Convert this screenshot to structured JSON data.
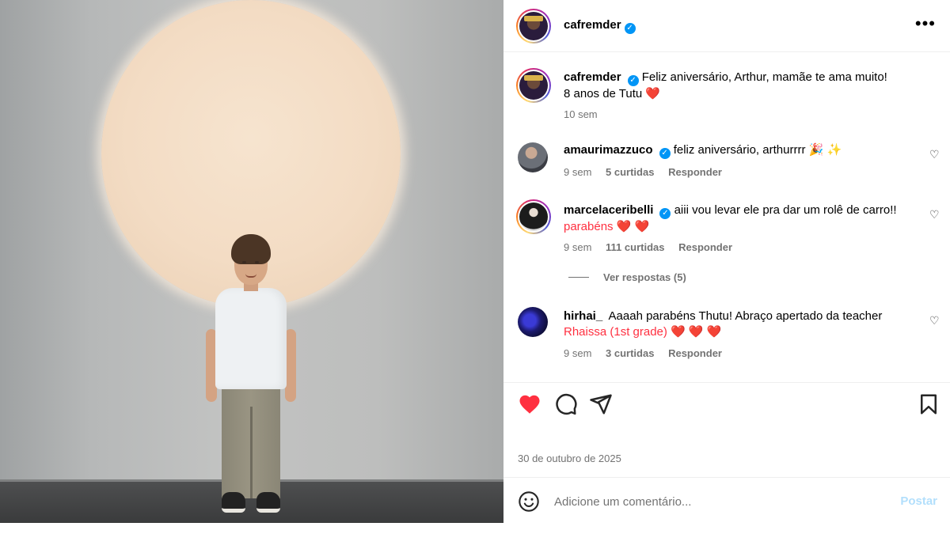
{
  "post": {
    "author": "cafremder",
    "caption_line1": "Feliz aniversário, Arthur, mamãe te ama muito!",
    "caption_line2": "8 anos de Tutu",
    "caption_emoji": "❤️",
    "caption_time": "10 sem",
    "date": "30 de outubro de 2025",
    "liked": true,
    "accent_color": "#0095f6",
    "like_color": "#ff3040"
  },
  "comments": [
    {
      "username": "amaurimazzuco",
      "verified": true,
      "text": "feliz aniversário, arthurrrr 🎉 ✨",
      "time": "9 sem",
      "likes": "5 curtidas",
      "reply": "Responder"
    },
    {
      "username": "marcelaceribelli",
      "verified": true,
      "text": "aiii vou levar ele pra dar um rolê de carro!!",
      "text_line2": "parabéns ❤️ ❤️",
      "time": "9 sem",
      "likes": "111 curtidas",
      "reply": "Responder",
      "view_replies": "Ver respostas (5)"
    },
    {
      "username": "hirhai_",
      "verified": false,
      "text": "Aaaah parabéns Thutu! Abraço apertado da teacher",
      "text_line2": "Rhaissa (1st grade) ❤️ ❤️ ❤️",
      "time": "9 sem",
      "likes": "3 curtidas",
      "reply": "Responder"
    }
  ],
  "comment_bar": {
    "placeholder": "Adicione um comentário...",
    "post_label": "Postar"
  },
  "icons": {
    "verified": "✓",
    "more": "•••",
    "heart_small": "♡"
  }
}
